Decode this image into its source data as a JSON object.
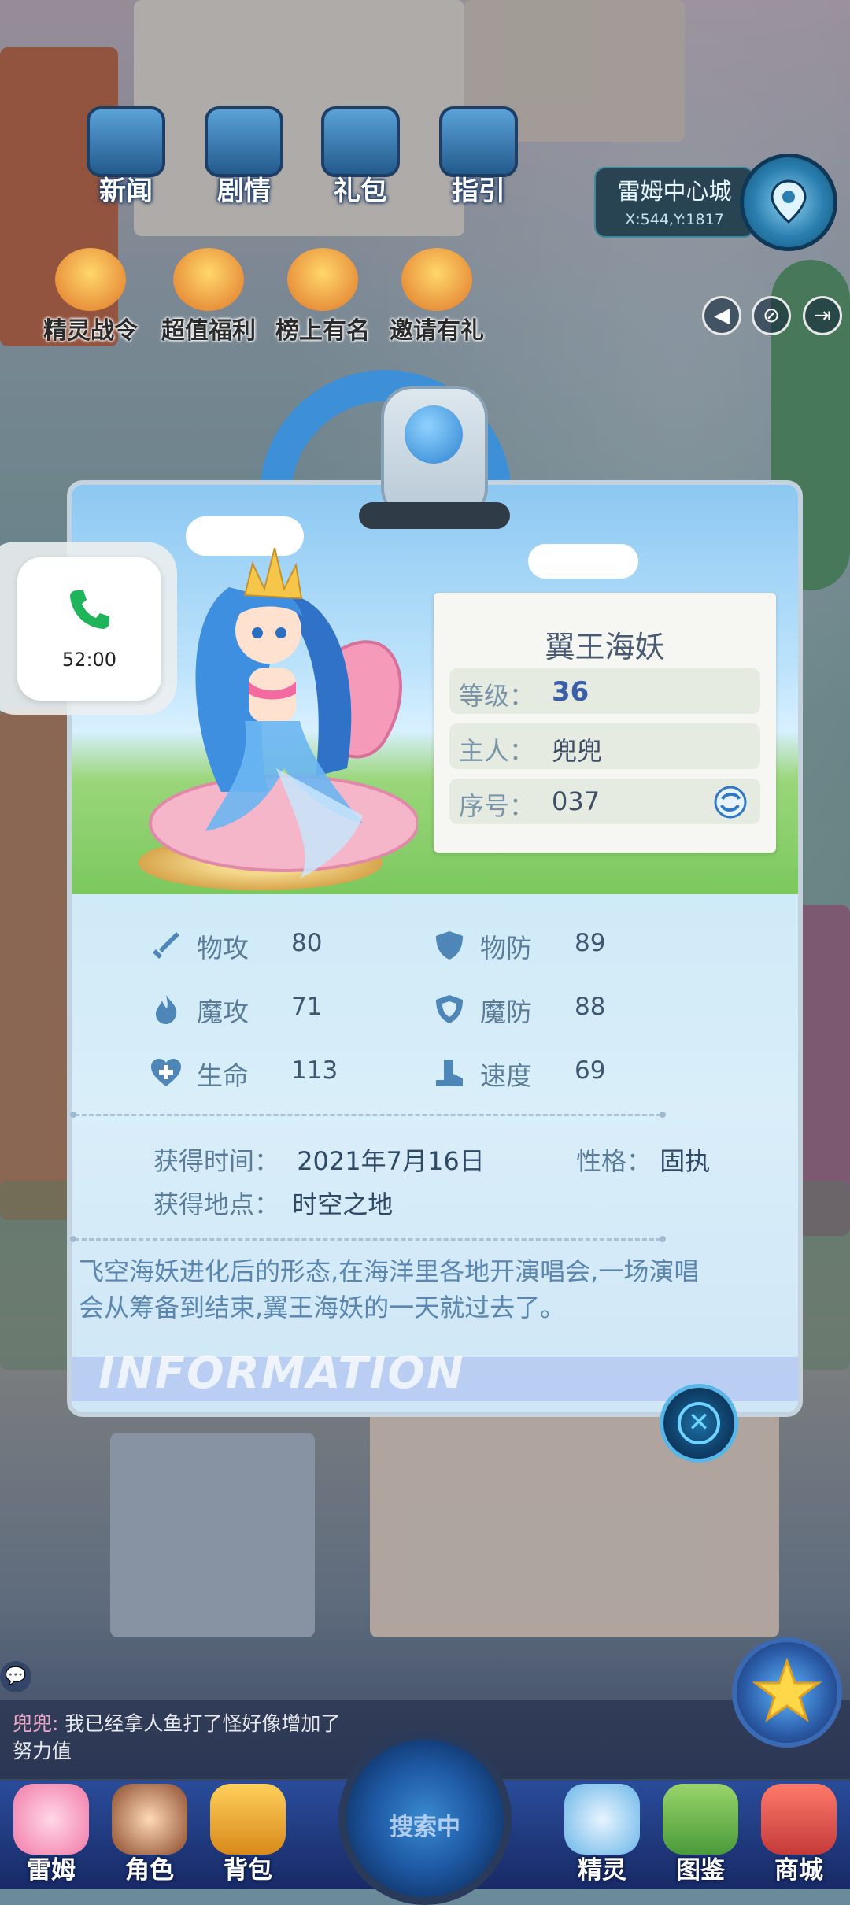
{
  "top_menu": [
    {
      "label": "新闻"
    },
    {
      "label": "剧情"
    },
    {
      "label": "礼包"
    },
    {
      "label": "指引"
    }
  ],
  "promos": [
    {
      "label": "精灵战令"
    },
    {
      "label": "超值福利"
    },
    {
      "label": "榜上有名"
    },
    {
      "label": "邀请有礼"
    }
  ],
  "location": {
    "name": "雷姆中心城",
    "coords": "X:544,Y:1817"
  },
  "call_popup": {
    "time": "52:00"
  },
  "pet_card": {
    "name": "翼王海妖",
    "fields": {
      "level_label": "等级：",
      "level_value": "36",
      "owner_label": "主人：",
      "owner_value": "兜兜",
      "index_label": "序号：",
      "index_value": "037"
    },
    "stats": [
      {
        "label": "物攻",
        "value": "80",
        "icon": "sword-icon"
      },
      {
        "label": "物防",
        "value": "89",
        "icon": "shield-icon"
      },
      {
        "label": "魔攻",
        "value": "71",
        "icon": "flame-icon"
      },
      {
        "label": "魔防",
        "value": "88",
        "icon": "magic-shield-icon"
      },
      {
        "label": "生命",
        "value": "113",
        "icon": "heart-plus-icon"
      },
      {
        "label": "速度",
        "value": "69",
        "icon": "boot-icon"
      }
    ],
    "obtained_time_label": "获得时间：",
    "obtained_time_value": "2021年7月16日",
    "personality_label": "性格：",
    "personality_value": "固执",
    "obtained_place_label": "获得地点：",
    "obtained_place_value": "时空之地",
    "description": "飞空海妖进化后的形态,在海洋里各地开演唱会,一场演唱会从筹备到结束,翼王海妖的一天就过去了。",
    "watermark": "INFORMATION"
  },
  "chat": {
    "sender": "兜兜:",
    "message": " 我已经拿人鱼打了怪好像增加了努力值"
  },
  "bottom_nav": [
    {
      "label": "雷姆"
    },
    {
      "label": "角色"
    },
    {
      "label": "背包"
    },
    {
      "label": "精灵"
    },
    {
      "label": "图鉴"
    },
    {
      "label": "商城"
    }
  ],
  "radar": {
    "label": "搜索中"
  },
  "colors": {
    "accent": "#3d8fd8",
    "card_bg": "#d7e3ec",
    "text_blue": "#5a86b0"
  }
}
